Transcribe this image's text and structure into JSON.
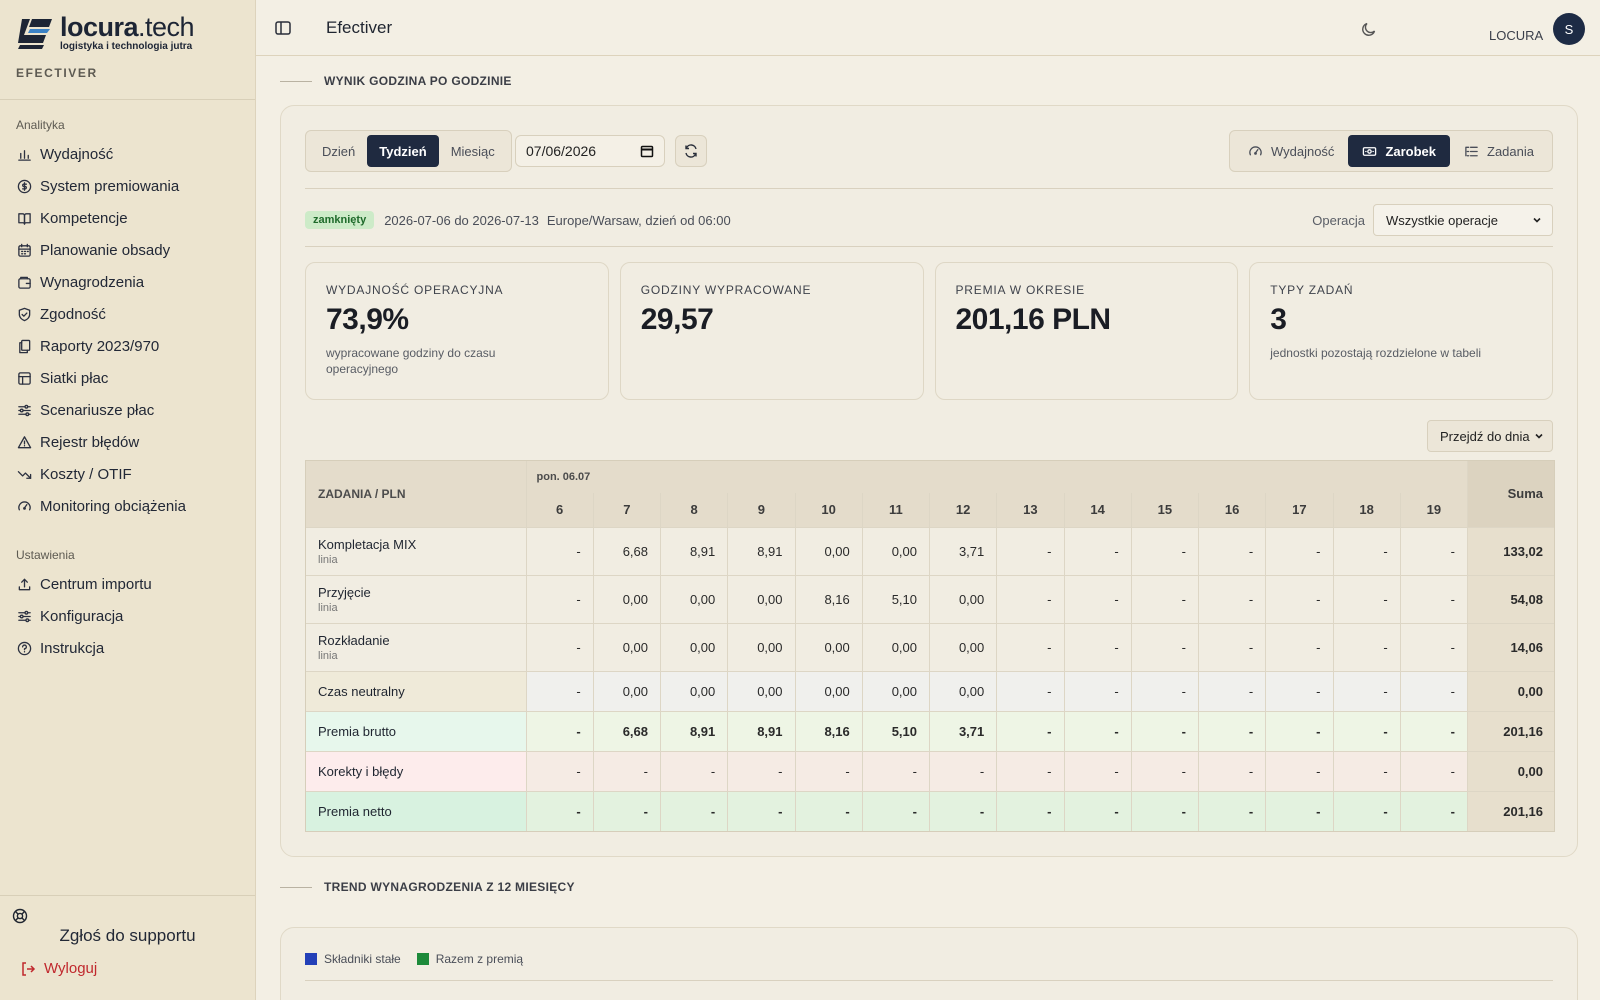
{
  "brand": {
    "name": "locura",
    "tld": ".tech",
    "tagline": "logistyka i technologia jutra",
    "product": "EFECTIVER"
  },
  "sidebar": {
    "section_analytics": "Analityka",
    "analytics_items": [
      {
        "label": "Wydajność",
        "icon": "bar-chart-icon"
      },
      {
        "label": "System premiowania",
        "icon": "dollar-circle-icon"
      },
      {
        "label": "Kompetencje",
        "icon": "book-icon"
      },
      {
        "label": "Planowanie obsady",
        "icon": "calendar-icon"
      },
      {
        "label": "Wynagrodzenia",
        "icon": "wallet-icon"
      },
      {
        "label": "Zgodność",
        "icon": "shield-check-icon"
      },
      {
        "label": "Raporty 2023/970",
        "icon": "files-icon"
      },
      {
        "label": "Siatki płac",
        "icon": "table-icon"
      },
      {
        "label": "Scenariusze płac",
        "icon": "sliders-icon"
      },
      {
        "label": "Rejestr błędów",
        "icon": "warning-icon"
      },
      {
        "label": "Koszty / OTIF",
        "icon": "trend-down-icon"
      },
      {
        "label": "Monitoring obciążenia",
        "icon": "gauge-icon"
      }
    ],
    "section_settings": "Ustawienia",
    "settings_items": [
      {
        "label": "Centrum importu",
        "icon": "upload-icon"
      },
      {
        "label": "Konfiguracja",
        "icon": "sliders-icon"
      },
      {
        "label": "Instrukcja",
        "icon": "help-circle-icon"
      }
    ],
    "support_label": "Zgłoś do supportu",
    "logout_label": "Wyloguj"
  },
  "topbar": {
    "title": "Efectiver",
    "org": "LOCURA",
    "avatar_initial": "S"
  },
  "section1": {
    "title": "WYNIK GODZINA PO GODZINIE"
  },
  "controls": {
    "period_tabs": [
      "Dzień",
      "Tydzień",
      "Miesiąc"
    ],
    "period_active": "Tydzień",
    "date_value": "07/06/2026",
    "view_tabs": [
      {
        "label": "Wydajność",
        "icon": "gauge-icon"
      },
      {
        "label": "Zarobek",
        "icon": "cash-icon"
      },
      {
        "label": "Zadania",
        "icon": "list-icon"
      }
    ],
    "view_active": "Zarobek"
  },
  "meta": {
    "status_badge": "zamknięty",
    "range": "2026-07-06 do 2026-07-13",
    "tz": "Europe/Warsaw, dzień od 06:00",
    "operation_label": "Operacja",
    "operation_value": "Wszystkie operacje"
  },
  "kpis": [
    {
      "label": "WYDAJNOŚĆ OPERACYJNA",
      "value": "73,9%",
      "note": "wypracowane godziny do czasu operacyjnego"
    },
    {
      "label": "GODZINY WYPRACOWANE",
      "value": "29,57",
      "note": ""
    },
    {
      "label": "PREMIA W OKRESIE",
      "value": "201,16 PLN",
      "note": ""
    },
    {
      "label": "TYPY ZADAŃ",
      "value": "3",
      "note": "jednostki pozostają rozdzielone w tabeli"
    }
  ],
  "jump_select": "Przejdź do dnia",
  "table": {
    "corner_header": "ZADANIA / PLN",
    "day_header": "pon. 06.07",
    "hours": [
      "6",
      "7",
      "8",
      "9",
      "10",
      "11",
      "12",
      "13",
      "14",
      "15",
      "16",
      "17",
      "18",
      "19"
    ],
    "sum_header": "Suma",
    "rows": [
      {
        "kind": "op",
        "name": "Kompletacja MIX",
        "sub": "linia",
        "cells": [
          "-",
          "6,68",
          "8,91",
          "8,91",
          "0,00",
          "0,00",
          "3,71",
          "-",
          "-",
          "-",
          "-",
          "-",
          "-",
          "-"
        ],
        "sum": "133,02"
      },
      {
        "kind": "op",
        "name": "Przyjęcie",
        "sub": "linia",
        "cells": [
          "-",
          "0,00",
          "0,00",
          "0,00",
          "8,16",
          "5,10",
          "0,00",
          "-",
          "-",
          "-",
          "-",
          "-",
          "-",
          "-"
        ],
        "sum": "54,08"
      },
      {
        "kind": "op",
        "name": "Rozkładanie",
        "sub": "linia",
        "cells": [
          "-",
          "0,00",
          "0,00",
          "0,00",
          "0,00",
          "0,00",
          "0,00",
          "-",
          "-",
          "-",
          "-",
          "-",
          "-",
          "-"
        ],
        "sum": "14,06"
      },
      {
        "kind": "neutral",
        "name": "Czas neutralny",
        "sub": "",
        "cells": [
          "-",
          "0,00",
          "0,00",
          "0,00",
          "0,00",
          "0,00",
          "0,00",
          "-",
          "-",
          "-",
          "-",
          "-",
          "-",
          "-"
        ],
        "sum": "0,00"
      },
      {
        "kind": "gross",
        "name": "Premia brutto",
        "sub": "",
        "cells": [
          "-",
          "6,68",
          "8,91",
          "8,91",
          "8,16",
          "5,10",
          "3,71",
          "-",
          "-",
          "-",
          "-",
          "-",
          "-",
          "-"
        ],
        "sum": "201,16"
      },
      {
        "kind": "corr",
        "name": "Korekty i błędy",
        "sub": "",
        "cells": [
          "-",
          "-",
          "-",
          "-",
          "-",
          "-",
          "-",
          "-",
          "-",
          "-",
          "-",
          "-",
          "-",
          "-"
        ],
        "sum": "0,00"
      },
      {
        "kind": "net",
        "name": "Premia netto",
        "sub": "",
        "cells": [
          "-",
          "-",
          "-",
          "-",
          "-",
          "-",
          "-",
          "-",
          "-",
          "-",
          "-",
          "-",
          "-",
          "-"
        ],
        "sum": "201,16"
      }
    ]
  },
  "section2": {
    "title": "TREND WYNAGRODZENIA Z 12 MIESIĘCY"
  },
  "legend": [
    {
      "label": "Składniki stałe",
      "color": "#2340b8"
    },
    {
      "label": "Razem z premią",
      "color": "#1d8a3a"
    }
  ]
}
